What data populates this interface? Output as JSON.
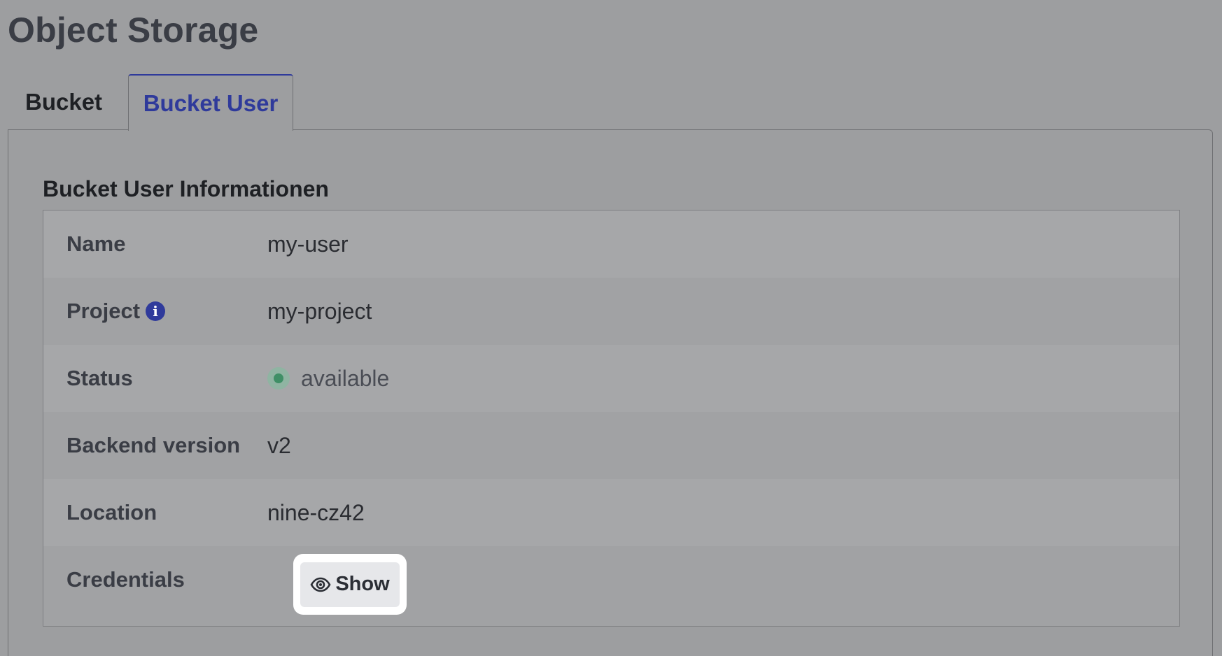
{
  "page": {
    "title": "Object Storage"
  },
  "tabs": [
    {
      "label": "Bucket",
      "active": false
    },
    {
      "label": "Bucket User",
      "active": true
    }
  ],
  "section": {
    "title": "Bucket User Informationen"
  },
  "fields": {
    "name": {
      "label": "Name",
      "value": "my-user"
    },
    "project": {
      "label": "Project",
      "value": "my-project",
      "info_icon": "info-icon"
    },
    "status": {
      "label": "Status",
      "value": "available",
      "indicator_color": "#3f8f66"
    },
    "backend_version": {
      "label": "Backend version",
      "value": "v2"
    },
    "location": {
      "label": "Location",
      "value": "nine-cz42"
    },
    "credentials": {
      "label": "Credentials",
      "button_label": "Show",
      "button_icon": "eye-icon"
    }
  },
  "colors": {
    "accent": "#2f3a9b",
    "status_available": "#3f8f66"
  }
}
